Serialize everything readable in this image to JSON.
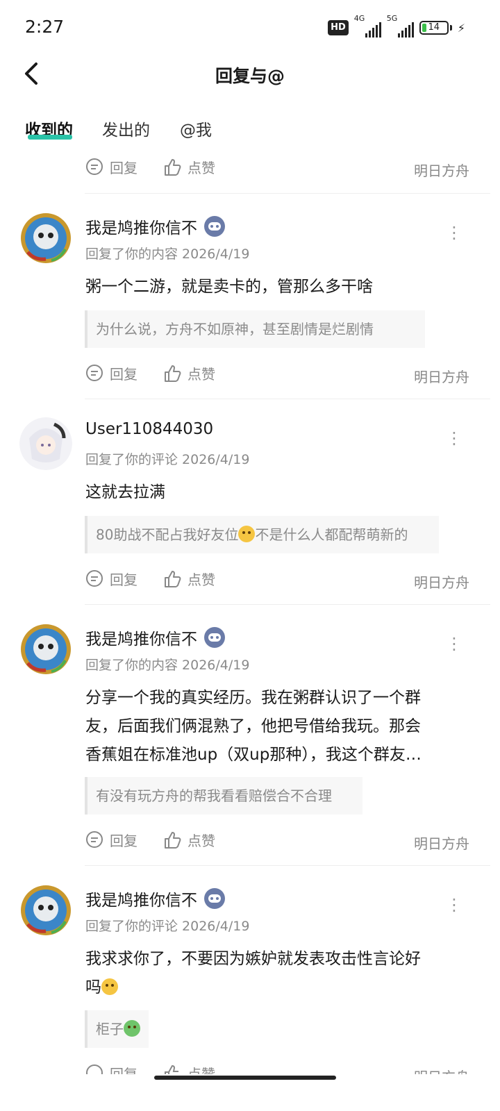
{
  "status_bar": {
    "time": "2:27",
    "hd_label": "HD",
    "net1_label": "4G",
    "net2_label": "5G",
    "battery_level": "14",
    "icons": [
      "signal-icon",
      "battery-icon",
      "charging-icon"
    ]
  },
  "header": {
    "title": "回复与@",
    "back_icon": "chevron-left-icon"
  },
  "tabs": [
    {
      "label": "收到的",
      "active": true
    },
    {
      "label": "发出的",
      "active": false
    },
    {
      "label": "@我",
      "active": false
    }
  ],
  "actions": {
    "reply_label": "回复",
    "like_label": "点赞"
  },
  "top_action_row": {
    "source": "明日方舟"
  },
  "items": [
    {
      "username": "我是鸠推你信不",
      "has_badge": true,
      "meta": "回复了你的内容 2026/4/19",
      "content": "粥一个二游，就是卖卡的，管那么多干啥",
      "quote": "为什么说，方舟不如原神，甚至剧情是烂剧情",
      "source": "明日方舟"
    },
    {
      "username": "User110844030",
      "has_badge": false,
      "meta": "回复了你的评论 2026/4/19",
      "content": "这就去拉满",
      "quote_pre": "80助战不配占我好友位",
      "quote_post": "不是什么人都配帮萌新的",
      "source": "明日方舟"
    },
    {
      "username": "我是鸠推你信不",
      "has_badge": true,
      "meta": "回复了你的内容 2026/4/19",
      "content_lines": [
        "分享一个我的真实经历。我在粥群认识了一个群",
        "友，后面我们俩混熟了，他把号借给我玩。那会",
        "香蕉姐在标准池up（双up那种），我这个群友…"
      ],
      "quote": "有没有玩方舟的帮我看看赔偿合不合理",
      "source": "明日方舟"
    },
    {
      "username": "我是鸠推你信不",
      "has_badge": true,
      "meta": "回复了你的评论 2026/4/19",
      "content_lines": [
        "我求求你了，不要因为嫉妒就发表攻击性言论好",
        "吗"
      ],
      "quote": "柜子",
      "source": "明日方舟"
    }
  ],
  "colors": {
    "accent": "#2ac3a8",
    "muted_text": "#888888",
    "badge": "#6a7ba8"
  }
}
